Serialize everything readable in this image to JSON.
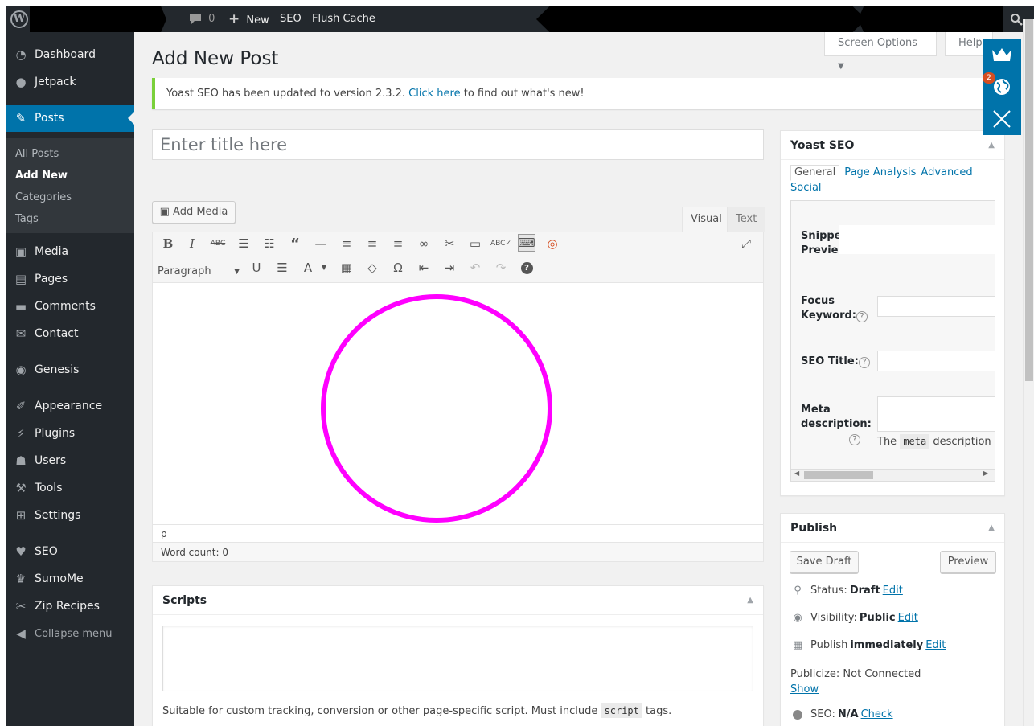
{
  "admin_bar": {
    "comments_count": "0",
    "new_label": "New",
    "seo_label": "SEO",
    "flush_cache_label": "Flush Cache"
  },
  "sidebar": {
    "items": [
      {
        "label": "Dashboard",
        "icon": "dashboard-icon"
      },
      {
        "label": "Jetpack",
        "icon": "jetpack-icon"
      },
      {
        "label": "Posts",
        "icon": "pin-icon"
      },
      {
        "label": "Media",
        "icon": "media-icon"
      },
      {
        "label": "Pages",
        "icon": "pages-icon"
      },
      {
        "label": "Comments",
        "icon": "comment-icon"
      },
      {
        "label": "Contact",
        "icon": "mail-icon"
      },
      {
        "label": "Genesis",
        "icon": "genesis-icon"
      },
      {
        "label": "Appearance",
        "icon": "brush-icon"
      },
      {
        "label": "Plugins",
        "icon": "plug-icon"
      },
      {
        "label": "Users",
        "icon": "user-icon"
      },
      {
        "label": "Tools",
        "icon": "wrench-icon"
      },
      {
        "label": "Settings",
        "icon": "settings-icon"
      },
      {
        "label": "SEO",
        "icon": "yoast-icon"
      },
      {
        "label": "SumoMe",
        "icon": "crown-icon"
      },
      {
        "label": "Zip Recipes",
        "icon": "carrot-icon"
      }
    ],
    "posts_submenu": [
      "All Posts",
      "Add New",
      "Categories",
      "Tags"
    ],
    "collapse_label": "Collapse menu"
  },
  "screen_options_label": "Screen Options",
  "help_label": "Help",
  "page_title": "Add New Post",
  "notice": {
    "before": "Yoast SEO has been updated to version 2.3.2.",
    "link": "Click here",
    "after": "to find out what's new!"
  },
  "title_placeholder": "Enter title here",
  "editor": {
    "add_media_label": "Add Media",
    "tab_visual": "Visual",
    "tab_text": "Text",
    "format_value": "Paragraph",
    "path": "p",
    "word_count": "Word count: 0",
    "annotation_color": "#ff00ff"
  },
  "scripts_box": {
    "title": "Scripts",
    "help_before": "Suitable for custom tracking, conversion or other page-specific script. Must include",
    "help_code": "script",
    "help_after": "tags."
  },
  "yoast": {
    "title": "Yoast SEO",
    "tabs": [
      "General",
      "Page Analysis",
      "Advanced",
      "Social"
    ],
    "snippet_label_1": "Snippet",
    "snippet_label_2": "Preview",
    "focus_label_1": "Focus",
    "focus_label_2": "Keyword:",
    "seo_title_label": "SEO Title:",
    "meta_label_1": "Meta",
    "meta_label_2": "description:",
    "meta_help_before": "The",
    "meta_help_code": "meta",
    "meta_help_after": "description"
  },
  "publish": {
    "title": "Publish",
    "save_draft": "Save Draft",
    "preview": "Preview",
    "status_label": "Status:",
    "status_value": "Draft",
    "visibility_label": "Visibility:",
    "visibility_value": "Public",
    "publish_label": "Publish",
    "publish_value": "immediately",
    "edit": "Edit",
    "publicize": "Publicize: Not Connected",
    "show": "Show",
    "seo_label": "SEO:",
    "seo_value": "N/A",
    "check": "Check"
  },
  "sumo_badge": "2",
  "colors": {
    "admin_dark": "#23282d",
    "accent_blue": "#0073aa",
    "notice_green": "#7ad03a",
    "annotation_magenta": "#ff00ff"
  }
}
